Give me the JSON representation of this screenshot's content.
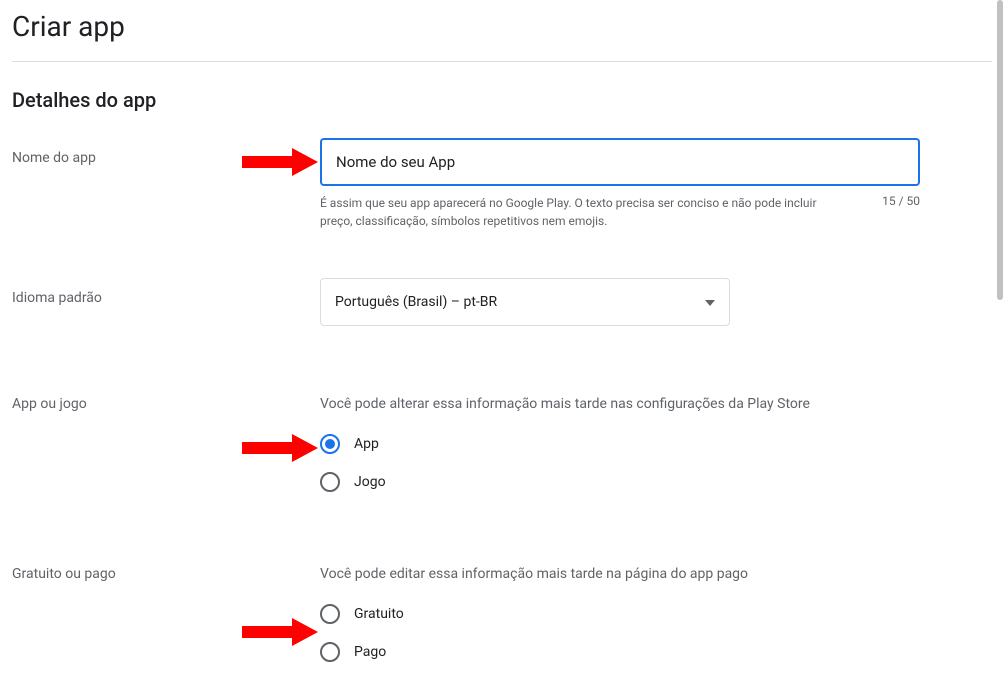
{
  "page": {
    "title": "Criar app"
  },
  "section": {
    "title": "Detalhes do app"
  },
  "app_name": {
    "label": "Nome do app",
    "value": "Nome do seu App",
    "helper": "É assim que seu app aparecerá no Google Play. O texto precisa ser conciso e não pode incluir preço, classificação, símbolos repetitivos nem emojis.",
    "char_current": "15",
    "char_max": "50"
  },
  "language": {
    "label": "Idioma padrão",
    "selected": "Português (Brasil) – pt-BR"
  },
  "app_or_game": {
    "label": "App ou jogo",
    "info": "Você pode alterar essa informação mais tarde nas configurações da Play Store",
    "options": {
      "app": "App",
      "game": "Jogo"
    },
    "selected": "app"
  },
  "free_or_paid": {
    "label": "Gratuito ou pago",
    "info": "Você pode editar essa informação mais tarde na página do app pago",
    "options": {
      "free": "Gratuito",
      "paid": "Pago"
    }
  }
}
